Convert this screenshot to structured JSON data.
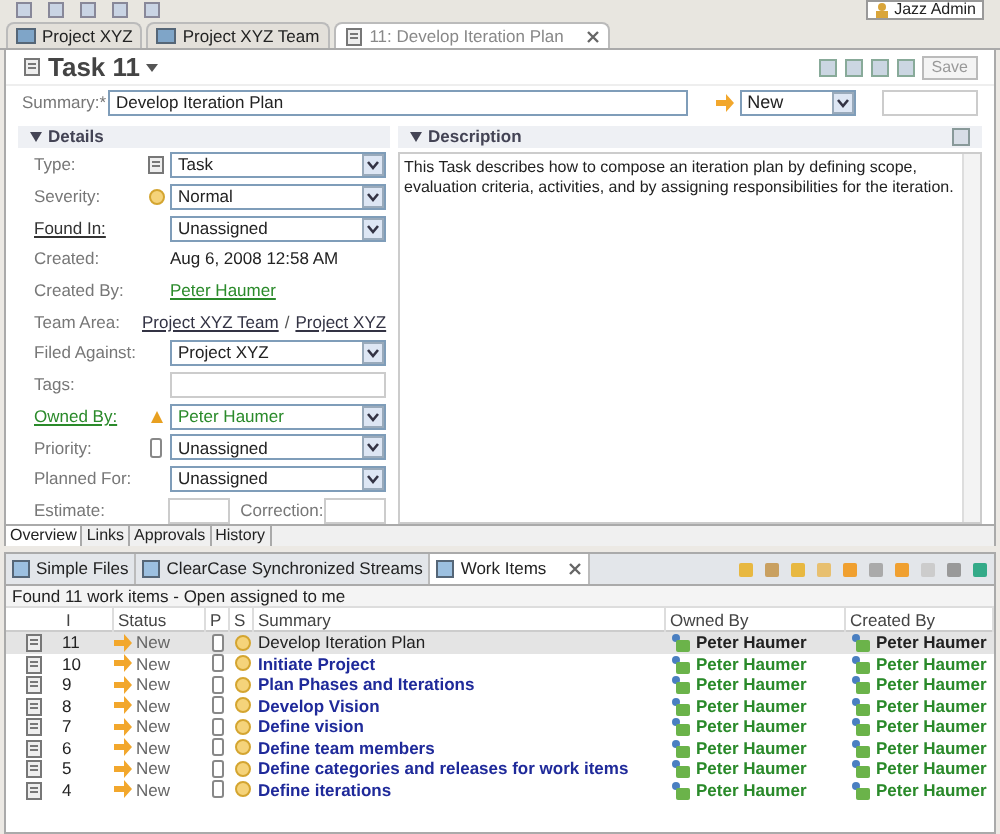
{
  "top_toolbar": {
    "user": "Jazz Admin"
  },
  "editor_tabs": [
    {
      "label": "Project XYZ",
      "selected": false
    },
    {
      "label": "Project XYZ Team",
      "selected": false
    },
    {
      "label": "11: Develop Iteration Plan",
      "selected": true
    }
  ],
  "header": {
    "title": "Task 11",
    "save": "Save"
  },
  "summary": {
    "label": "Summary:*",
    "value": "Develop Iteration Plan",
    "state": "New"
  },
  "details": {
    "title": "Details",
    "fields": [
      {
        "kind": "combo",
        "label": "Type:",
        "value": "Task",
        "link": false
      },
      {
        "kind": "combo",
        "label": "Severity:",
        "value": "Normal",
        "link": false
      },
      {
        "kind": "combo",
        "label": "Found In:",
        "value": "Unassigned",
        "link": true
      },
      {
        "kind": "text",
        "label": "Created:",
        "value": "Aug 6, 2008 12:58 AM",
        "link": false
      },
      {
        "kind": "person",
        "label": "Created By:",
        "value": "Peter Haumer",
        "link": false
      },
      {
        "kind": "links",
        "label": "Team Area:",
        "values": [
          "Project XYZ Team",
          "Project XYZ"
        ],
        "separator": "/",
        "link": false
      },
      {
        "kind": "combo",
        "label": "Filed Against:",
        "value": "Project XYZ",
        "link": false
      },
      {
        "kind": "input",
        "label": "Tags:",
        "link": false
      },
      {
        "kind": "owner",
        "label": "Owned By:",
        "value": "Peter Haumer",
        "link": true
      },
      {
        "kind": "combo",
        "label": "Priority:",
        "value": "Unassigned",
        "link": false
      },
      {
        "kind": "combo",
        "label": "Planned For:",
        "value": "Unassigned",
        "link": false
      },
      {
        "kind": "pair",
        "label": "Estimate:",
        "label2": "Correction:",
        "link": false
      }
    ]
  },
  "description": {
    "title": "Description",
    "text": "This Task describes how to compose an iteration plan by defining scope, evaluation criteria, activities, and by assigning responsibilities for the iteration."
  },
  "page_tabs": [
    {
      "label": "Overview",
      "selected": true
    },
    {
      "label": "Links",
      "selected": false
    },
    {
      "label": "Approvals",
      "selected": false
    },
    {
      "label": "History",
      "selected": false
    }
  ],
  "view_tabs": [
    {
      "label": "Simple Files",
      "selected": false
    },
    {
      "label": "ClearCase Synchronized Streams",
      "selected": false
    },
    {
      "label": "Work Items",
      "selected": true
    }
  ],
  "work_items": {
    "status_line": "Found 11 work items - Open assigned to me",
    "columns": [
      "I",
      "Status",
      "P",
      "S",
      "Summary",
      "Owned By",
      "Created By"
    ],
    "rows": [
      {
        "id": "11",
        "status": "New",
        "summary": "Develop Iteration Plan",
        "owned_by": "Peter Haumer",
        "created_by": "Peter Haumer",
        "selected": true
      },
      {
        "id": "10",
        "status": "New",
        "summary": "Initiate Project",
        "owned_by": "Peter Haumer",
        "created_by": "Peter Haumer",
        "selected": false
      },
      {
        "id": "9",
        "status": "New",
        "summary": "Plan Phases and Iterations",
        "owned_by": "Peter Haumer",
        "created_by": "Peter Haumer",
        "selected": false
      },
      {
        "id": "8",
        "status": "New",
        "summary": "Develop Vision",
        "owned_by": "Peter Haumer",
        "created_by": "Peter Haumer",
        "selected": false
      },
      {
        "id": "7",
        "status": "New",
        "summary": "Define vision",
        "owned_by": "Peter Haumer",
        "created_by": "Peter Haumer",
        "selected": false
      },
      {
        "id": "6",
        "status": "New",
        "summary": "Define team members",
        "owned_by": "Peter Haumer",
        "created_by": "Peter Haumer",
        "selected": false
      },
      {
        "id": "5",
        "status": "New",
        "summary": "Define categories and releases for work items",
        "owned_by": "Peter Haumer",
        "created_by": "Peter Haumer",
        "selected": false
      },
      {
        "id": "4",
        "status": "New",
        "summary": "Define iterations",
        "owned_by": "Peter Haumer",
        "created_by": "Peter Haumer",
        "selected": false
      }
    ]
  }
}
